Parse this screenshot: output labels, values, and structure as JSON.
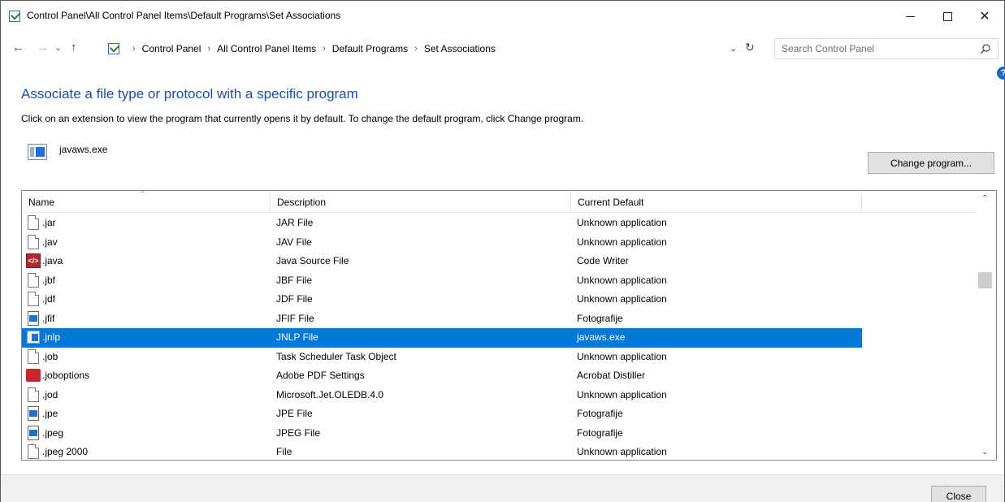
{
  "window": {
    "title": "Control Panel\\All Control Panel Items\\Default Programs\\Set Associations"
  },
  "nav": {
    "breadcrumbs": [
      "Control Panel",
      "All Control Panel Items",
      "Default Programs",
      "Set Associations"
    ],
    "search_placeholder": "Search Control Panel"
  },
  "content": {
    "heading": "Associate a file type or protocol with a specific program",
    "instructions": "Click on an extension to view the program that currently opens it by default. To change the default program, click Change program.",
    "current_program": "javaws.exe",
    "change_button": "Change program..."
  },
  "list": {
    "columns": {
      "name": "Name",
      "description": "Description",
      "current_default": "Current Default"
    },
    "rows": [
      {
        "name": ".jar",
        "description": "JAR File",
        "current_default": "Unknown application",
        "icon": "file-icon"
      },
      {
        "name": ".jav",
        "description": "JAV File",
        "current_default": "Unknown application",
        "icon": "file-icon"
      },
      {
        "name": ".java",
        "description": "Java Source File",
        "current_default": "Code Writer",
        "icon": "code-writer-icon"
      },
      {
        "name": ".jbf",
        "description": "JBF File",
        "current_default": "Unknown application",
        "icon": "file-icon"
      },
      {
        "name": ".jdf",
        "description": "JDF File",
        "current_default": "Unknown application",
        "icon": "file-icon"
      },
      {
        "name": ".jfif",
        "description": "JFIF File",
        "current_default": "Fotografije",
        "icon": "image-file-icon"
      },
      {
        "name": ".jnlp",
        "description": "JNLP File",
        "current_default": "javaws.exe",
        "icon": "javaws-icon",
        "selected": true
      },
      {
        "name": ".job",
        "description": "Task Scheduler Task Object",
        "current_default": "Unknown application",
        "icon": "file-icon"
      },
      {
        "name": ".joboptions",
        "description": "Adobe PDF Settings",
        "current_default": "Acrobat  Distiller",
        "icon": "acrobat-icon"
      },
      {
        "name": ".jod",
        "description": "Microsoft.Jet.OLEDB.4.0",
        "current_default": "Unknown application",
        "icon": "file-icon"
      },
      {
        "name": ".jpe",
        "description": "JPE File",
        "current_default": "Fotografije",
        "icon": "image-file-icon"
      },
      {
        "name": ".jpeg",
        "description": "JPEG File",
        "current_default": "Fotografije",
        "icon": "image-file-icon"
      },
      {
        "name": ".jpeg 2000",
        "description": "File",
        "current_default": "Unknown application",
        "icon": "file-icon"
      }
    ]
  },
  "footer": {
    "close_button": "Close"
  },
  "colors": {
    "heading": "#1c4fa3",
    "selection": "#0078d7"
  }
}
